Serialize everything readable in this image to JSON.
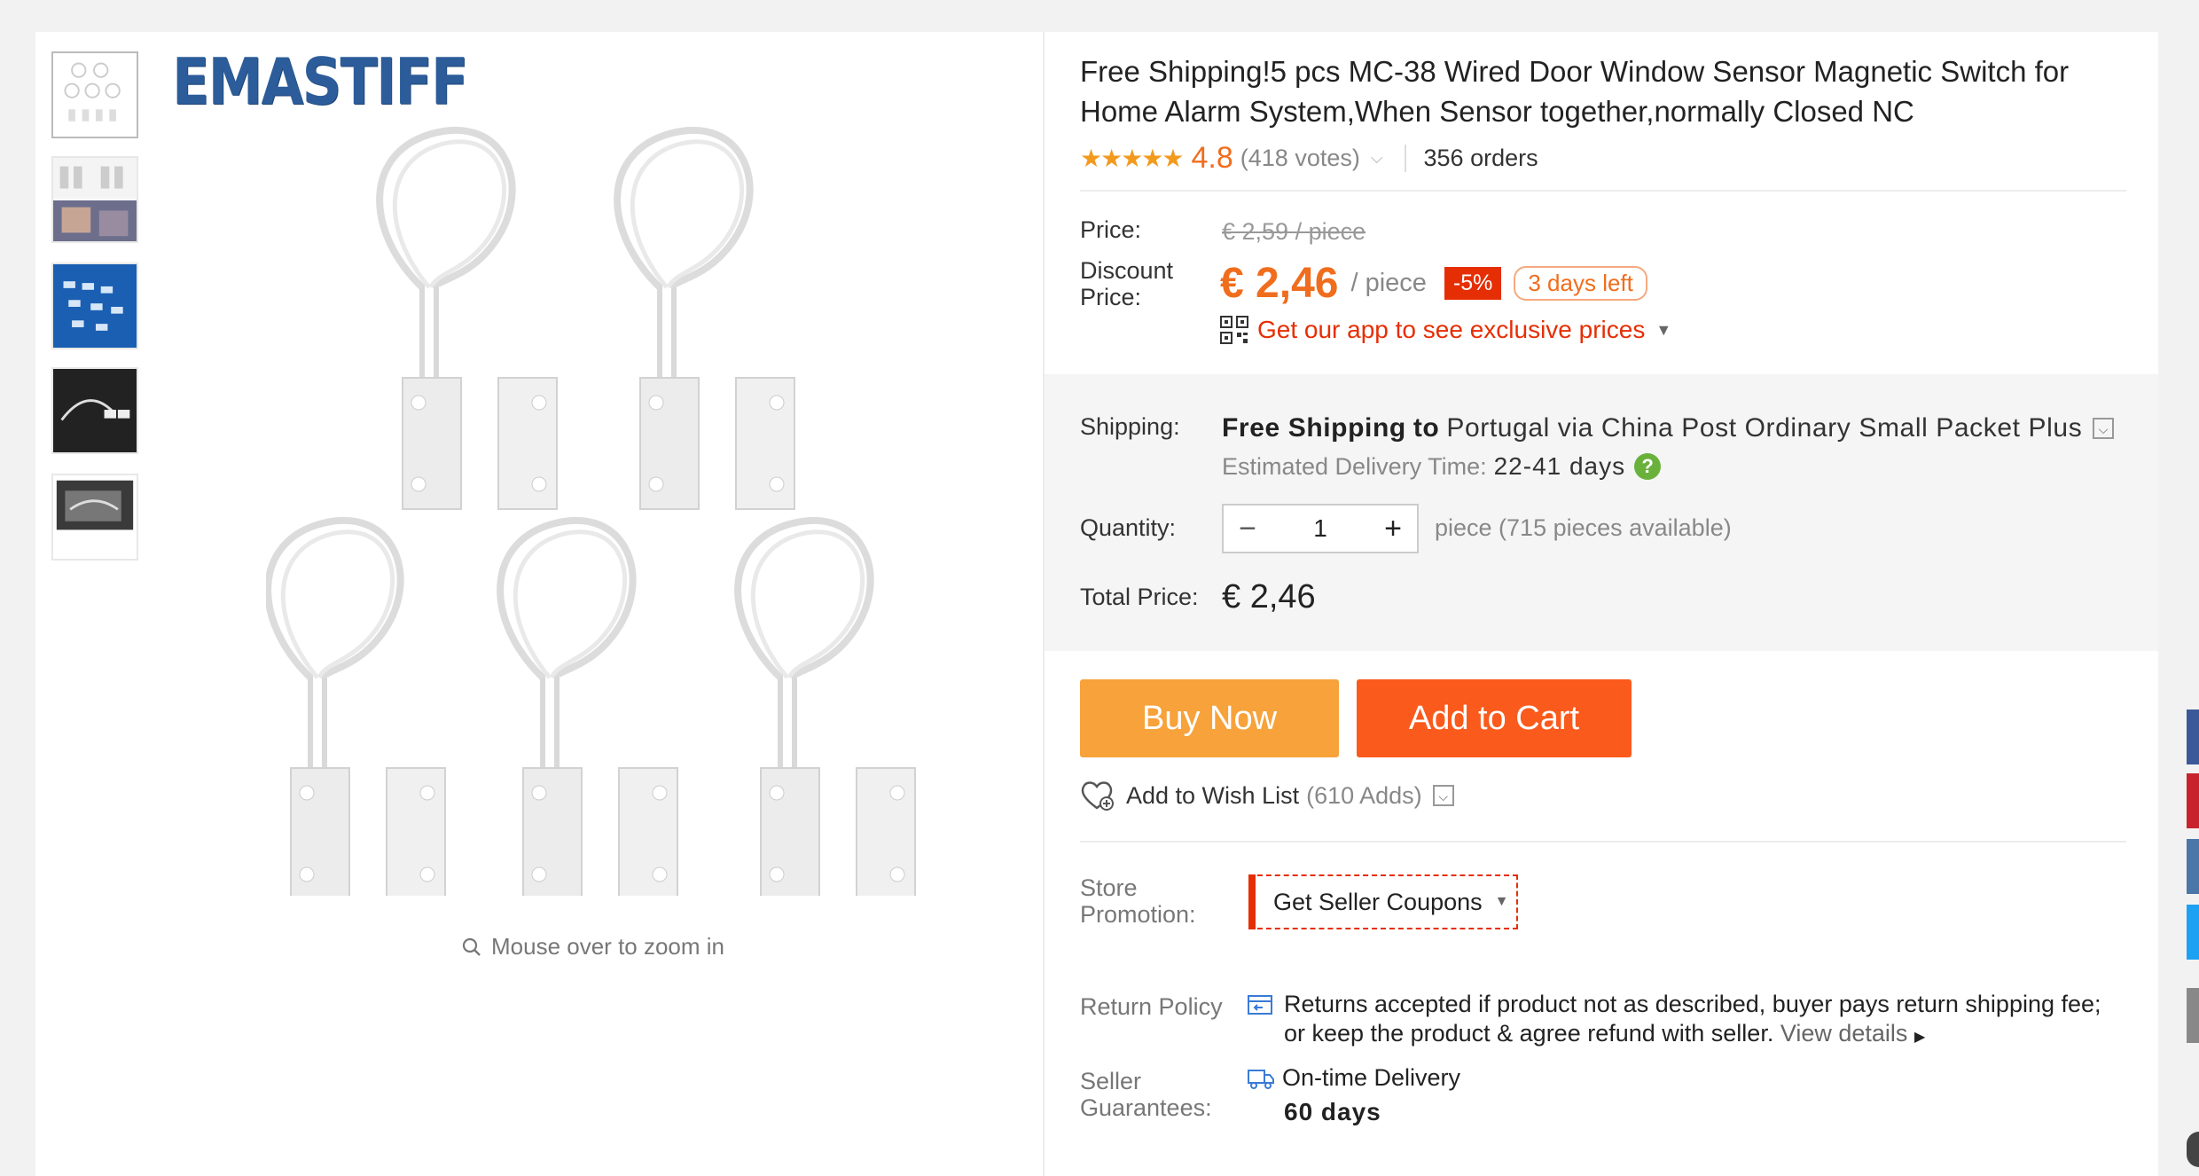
{
  "gallery": {
    "brand": "EMASTIFF",
    "thumbnails": [
      "Product image 1",
      "Product image 2",
      "Product image 3",
      "Product image 4",
      "Product image 5"
    ],
    "zoom_hint": "Mouse over to zoom in"
  },
  "product": {
    "title": "Free Shipping!5 pcs MC-38 Wired Door Window Sensor Magnetic Switch for Home Alarm System,When Sensor together,normally Closed NC",
    "stars": "★★★★★",
    "rating": "4.8",
    "votes": "(418 votes)",
    "orders": "356 orders"
  },
  "price": {
    "price_label": "Price:",
    "original": "€ 2,59 / piece",
    "discount_label_1": "Discount",
    "discount_label_2": "Price:",
    "discount": "€ 2,46",
    "per_piece": "/ piece",
    "percent_off": "-5%",
    "days_left": "3 days left",
    "app_promo": "Get our app to see exclusive prices"
  },
  "shipping": {
    "label": "Shipping:",
    "free": "Free Shipping",
    "to": "to",
    "destination": "Portugal via China Post Ordinary Small Packet Plus",
    "estimate_label": "Estimated Delivery Time:",
    "estimate_days": "22-41 days"
  },
  "quantity": {
    "label": "Quantity:",
    "value": "1",
    "available": "piece (715 pieces available)"
  },
  "total": {
    "label": "Total Price:",
    "value": "€ 2,46"
  },
  "actions": {
    "buy_now": "Buy Now",
    "add_to_cart": "Add to Cart",
    "wish_list": "Add to Wish List",
    "wish_count": "(610 Adds)"
  },
  "store_promotion": {
    "label_1": "Store",
    "label_2": "Promotion:",
    "coupon": "Get Seller Coupons"
  },
  "return_policy": {
    "label": "Return Policy",
    "line_1": "Returns accepted if product not as described, buyer pays return shipping fee;",
    "line_2": "or keep the product & agree refund with seller.",
    "link": "View details"
  },
  "guarantees": {
    "label_1": "Seller",
    "label_2": "Guarantees:",
    "on_time": "On-time Delivery",
    "days": "60 days"
  },
  "colors": {
    "accent_orange": "#f06d1d",
    "buy_now": "#f7a23a",
    "add_to_cart": "#fa5a1c",
    "sale_red": "#e62e04",
    "brand_blue": "#2c5d9a"
  }
}
